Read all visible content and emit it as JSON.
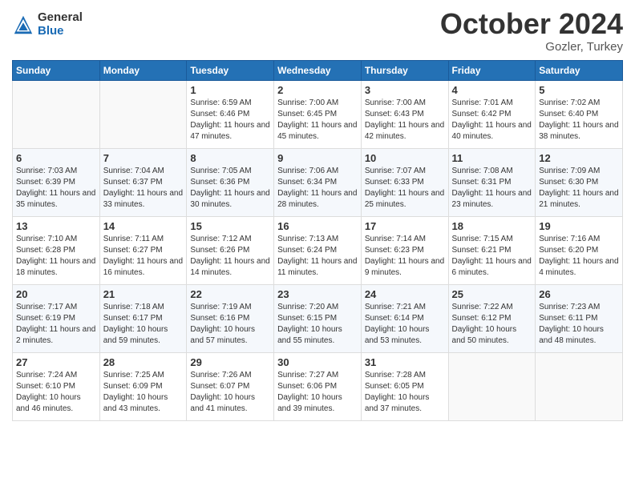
{
  "header": {
    "logo_general": "General",
    "logo_blue": "Blue",
    "month_title": "October 2024",
    "location": "Gozler, Turkey"
  },
  "weekdays": [
    "Sunday",
    "Monday",
    "Tuesday",
    "Wednesday",
    "Thursday",
    "Friday",
    "Saturday"
  ],
  "weeks": [
    [
      {
        "day": "",
        "info": ""
      },
      {
        "day": "",
        "info": ""
      },
      {
        "day": "1",
        "info": "Sunrise: 6:59 AM\nSunset: 6:46 PM\nDaylight: 11 hours and 47 minutes."
      },
      {
        "day": "2",
        "info": "Sunrise: 7:00 AM\nSunset: 6:45 PM\nDaylight: 11 hours and 45 minutes."
      },
      {
        "day": "3",
        "info": "Sunrise: 7:00 AM\nSunset: 6:43 PM\nDaylight: 11 hours and 42 minutes."
      },
      {
        "day": "4",
        "info": "Sunrise: 7:01 AM\nSunset: 6:42 PM\nDaylight: 11 hours and 40 minutes."
      },
      {
        "day": "5",
        "info": "Sunrise: 7:02 AM\nSunset: 6:40 PM\nDaylight: 11 hours and 38 minutes."
      }
    ],
    [
      {
        "day": "6",
        "info": "Sunrise: 7:03 AM\nSunset: 6:39 PM\nDaylight: 11 hours and 35 minutes."
      },
      {
        "day": "7",
        "info": "Sunrise: 7:04 AM\nSunset: 6:37 PM\nDaylight: 11 hours and 33 minutes."
      },
      {
        "day": "8",
        "info": "Sunrise: 7:05 AM\nSunset: 6:36 PM\nDaylight: 11 hours and 30 minutes."
      },
      {
        "day": "9",
        "info": "Sunrise: 7:06 AM\nSunset: 6:34 PM\nDaylight: 11 hours and 28 minutes."
      },
      {
        "day": "10",
        "info": "Sunrise: 7:07 AM\nSunset: 6:33 PM\nDaylight: 11 hours and 25 minutes."
      },
      {
        "day": "11",
        "info": "Sunrise: 7:08 AM\nSunset: 6:31 PM\nDaylight: 11 hours and 23 minutes."
      },
      {
        "day": "12",
        "info": "Sunrise: 7:09 AM\nSunset: 6:30 PM\nDaylight: 11 hours and 21 minutes."
      }
    ],
    [
      {
        "day": "13",
        "info": "Sunrise: 7:10 AM\nSunset: 6:28 PM\nDaylight: 11 hours and 18 minutes."
      },
      {
        "day": "14",
        "info": "Sunrise: 7:11 AM\nSunset: 6:27 PM\nDaylight: 11 hours and 16 minutes."
      },
      {
        "day": "15",
        "info": "Sunrise: 7:12 AM\nSunset: 6:26 PM\nDaylight: 11 hours and 14 minutes."
      },
      {
        "day": "16",
        "info": "Sunrise: 7:13 AM\nSunset: 6:24 PM\nDaylight: 11 hours and 11 minutes."
      },
      {
        "day": "17",
        "info": "Sunrise: 7:14 AM\nSunset: 6:23 PM\nDaylight: 11 hours and 9 minutes."
      },
      {
        "day": "18",
        "info": "Sunrise: 7:15 AM\nSunset: 6:21 PM\nDaylight: 11 hours and 6 minutes."
      },
      {
        "day": "19",
        "info": "Sunrise: 7:16 AM\nSunset: 6:20 PM\nDaylight: 11 hours and 4 minutes."
      }
    ],
    [
      {
        "day": "20",
        "info": "Sunrise: 7:17 AM\nSunset: 6:19 PM\nDaylight: 11 hours and 2 minutes."
      },
      {
        "day": "21",
        "info": "Sunrise: 7:18 AM\nSunset: 6:17 PM\nDaylight: 10 hours and 59 minutes."
      },
      {
        "day": "22",
        "info": "Sunrise: 7:19 AM\nSunset: 6:16 PM\nDaylight: 10 hours and 57 minutes."
      },
      {
        "day": "23",
        "info": "Sunrise: 7:20 AM\nSunset: 6:15 PM\nDaylight: 10 hours and 55 minutes."
      },
      {
        "day": "24",
        "info": "Sunrise: 7:21 AM\nSunset: 6:14 PM\nDaylight: 10 hours and 53 minutes."
      },
      {
        "day": "25",
        "info": "Sunrise: 7:22 AM\nSunset: 6:12 PM\nDaylight: 10 hours and 50 minutes."
      },
      {
        "day": "26",
        "info": "Sunrise: 7:23 AM\nSunset: 6:11 PM\nDaylight: 10 hours and 48 minutes."
      }
    ],
    [
      {
        "day": "27",
        "info": "Sunrise: 7:24 AM\nSunset: 6:10 PM\nDaylight: 10 hours and 46 minutes."
      },
      {
        "day": "28",
        "info": "Sunrise: 7:25 AM\nSunset: 6:09 PM\nDaylight: 10 hours and 43 minutes."
      },
      {
        "day": "29",
        "info": "Sunrise: 7:26 AM\nSunset: 6:07 PM\nDaylight: 10 hours and 41 minutes."
      },
      {
        "day": "30",
        "info": "Sunrise: 7:27 AM\nSunset: 6:06 PM\nDaylight: 10 hours and 39 minutes."
      },
      {
        "day": "31",
        "info": "Sunrise: 7:28 AM\nSunset: 6:05 PM\nDaylight: 10 hours and 37 minutes."
      },
      {
        "day": "",
        "info": ""
      },
      {
        "day": "",
        "info": ""
      }
    ]
  ]
}
